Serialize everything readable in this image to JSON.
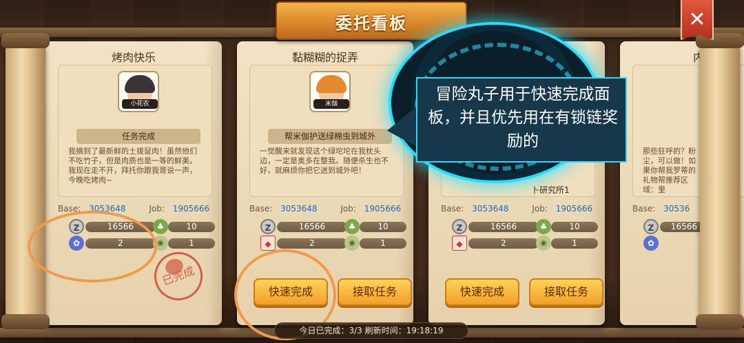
{
  "header": {
    "title": "委托看板",
    "close_symbol": "✕"
  },
  "cards": [
    {
      "title": "烤肉快乐",
      "npc_name": "小花农",
      "subtitle": "任务完成",
      "description": "我摘到了最新鲜的土拨鼠肉！虽然他们不吃竹子，但是肉质也是一等的鲜美。我现在走不开，拜托你跟我哥说一声，今晚吃烤肉~",
      "base_label": "Base:",
      "base_value": "3053648",
      "job_label": "Job:",
      "job_value": "1905666",
      "zeny": "16566",
      "item_count": "10",
      "reward_a": "2",
      "reward_b": "1",
      "stamp": "已完成"
    },
    {
      "title": "黏糊糊的捉弄",
      "npc_name": "米伽",
      "subtitle": "帮米伽护送绿棉虫到城外",
      "description": "一觉醒来就发现这个绿坨坨在我枕头边，一定是奥多在整我。随便杀生也不好，就麻烦你把它送到城外吧！",
      "base_label": "Base:",
      "base_value": "3053648",
      "job_label": "Job:",
      "job_value": "1905666",
      "zeny": "16566",
      "item_count": "10",
      "reward_a": "2",
      "reward_b": "1",
      "button_quick": "快速完成",
      "button_accept": "接取任务"
    },
    {
      "subtitle_fragment": "卜研究所1",
      "base_label": "Base:",
      "base_value": "3053648",
      "job_label": "Job:",
      "job_value": "1905666",
      "zeny": "16566",
      "item_count": "10",
      "reward_a": "2",
      "reward_b": "1",
      "button_quick": "快速完成",
      "button_accept": "接取任务"
    },
    {
      "title_fragment": "内",
      "description_fragment": "那些狂呼的？粉尘，可以做！如果你帮我罗蒂的礼物帮推荐区域：里",
      "base_label": "Base:",
      "base_value": "30536",
      "zeny": "16566"
    }
  ],
  "tooltip": {
    "text": "冒险丸子用于快速完成面板，并且优先用在有锁链奖励的"
  },
  "footer": {
    "text": "今日已完成：3/3  刷新时间：19:18:19"
  },
  "colors": {
    "accent_orange": "#f19a4a",
    "tooltip_cyan": "#2ed8ff",
    "button_gold": "#f0a02a",
    "stamp_red": "#d24a36"
  }
}
